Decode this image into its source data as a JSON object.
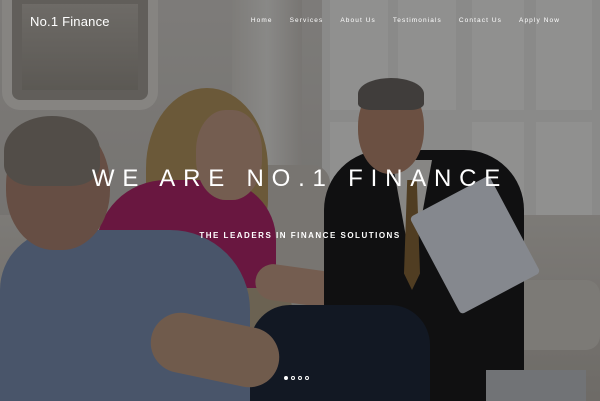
{
  "brand": {
    "name": "No.1 Finance"
  },
  "nav": {
    "items": [
      {
        "label": "Home"
      },
      {
        "label": "Services"
      },
      {
        "label": "About Us"
      },
      {
        "label": "Testimonials"
      },
      {
        "label": "Contact Us"
      },
      {
        "label": "Apply Now"
      }
    ]
  },
  "hero": {
    "headline": "WE ARE NO.1 FINANCE",
    "tagline": "THE LEADERS IN FINANCE SOLUTIONS",
    "carousel": {
      "slide_count": 4,
      "active_index": 0
    }
  },
  "colors": {
    "text": "#ffffff",
    "overlay": "rgba(0,0,0,0.42)"
  }
}
